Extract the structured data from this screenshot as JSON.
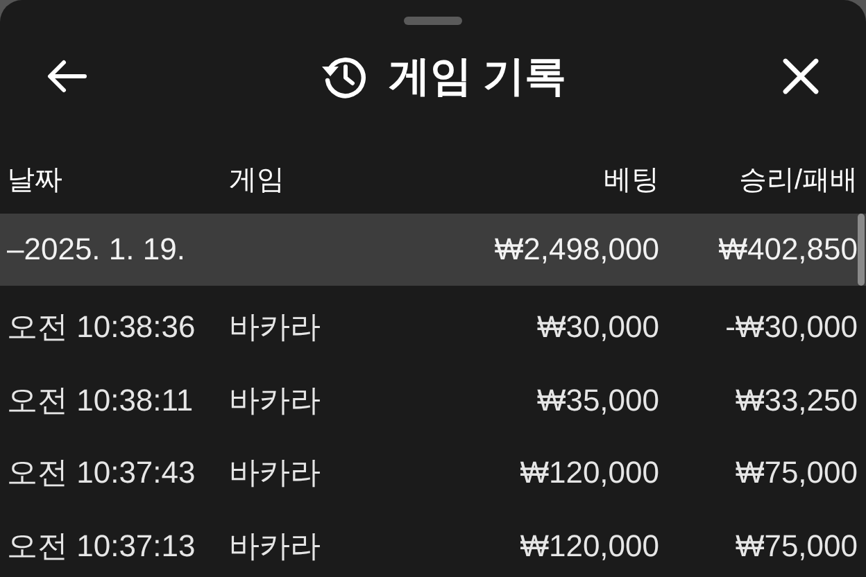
{
  "header": {
    "title": "게임 기록"
  },
  "table": {
    "columns": [
      "날짜",
      "게임",
      "베팅",
      "승리/패배"
    ],
    "group": {
      "toggle": "–",
      "date": "2025. 1. 19.",
      "bet": "₩2,498,000",
      "result": "₩402,850",
      "selected": true
    },
    "rows": [
      {
        "time": "오전 10:38:36",
        "game": "바카라",
        "bet": "₩30,000",
        "result": "-₩30,000"
      },
      {
        "time": "오전 10:38:11",
        "game": "바카라",
        "bet": "₩35,000",
        "result": "₩33,250"
      },
      {
        "time": "오전 10:37:43",
        "game": "바카라",
        "bet": "₩120,000",
        "result": "₩75,000"
      },
      {
        "time": "오전 10:37:13",
        "game": "바카라",
        "bet": "₩120,000",
        "result": "₩75,000"
      }
    ]
  }
}
